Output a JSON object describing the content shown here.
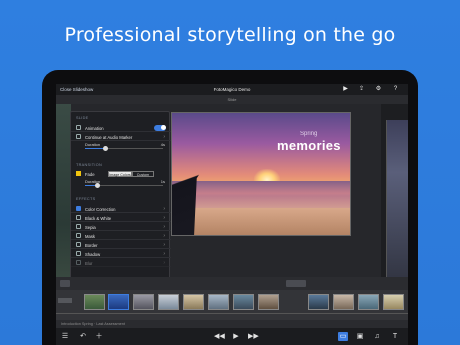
{
  "headline": "Professional storytelling on the go",
  "topbar": {
    "close_label": "Close Slideshow",
    "title": "FotoMagico Demo",
    "icons": [
      "play-icon",
      "share-icon",
      "gear-icon",
      "help-icon"
    ],
    "help_label": "?"
  },
  "slidebar": {
    "label": "Slide"
  },
  "slide": {
    "caption_small": "Spring",
    "caption_big": "memories"
  },
  "panel": {
    "slide_section": "SLIDE",
    "animation_label": "Animation",
    "continue_audio_label": "Continue at Audio Marker",
    "duration_label": "Duration",
    "duration_value": "4s",
    "transition_section": "TRANSITION",
    "fade_label": "Fade",
    "seg_options": [
      "Image Colors",
      "Custom"
    ],
    "trans_duration_label": "Duration",
    "trans_duration_value": "1s",
    "effects_section": "EFFECTS",
    "effects": [
      {
        "label": "Color Correction",
        "checked": true
      },
      {
        "label": "Black & White",
        "checked": false
      },
      {
        "label": "Sepia",
        "checked": false
      },
      {
        "label": "Mask",
        "checked": false
      },
      {
        "label": "Border",
        "checked": false
      },
      {
        "label": "Shadow",
        "checked": false
      },
      {
        "label": "Blur",
        "checked": false
      }
    ]
  },
  "infobar": {
    "text": "Introduction Spring · Last Assessment"
  },
  "bottombar": {
    "icons": [
      "list-icon",
      "undo-icon",
      "add-icon",
      "rewind-icon",
      "play-icon",
      "fast-forward-icon",
      "slides-icon",
      "image-icon",
      "music-icon",
      "text-icon"
    ]
  },
  "colors": {
    "background": "#2f7fe0",
    "accent": "#3d7de0"
  }
}
